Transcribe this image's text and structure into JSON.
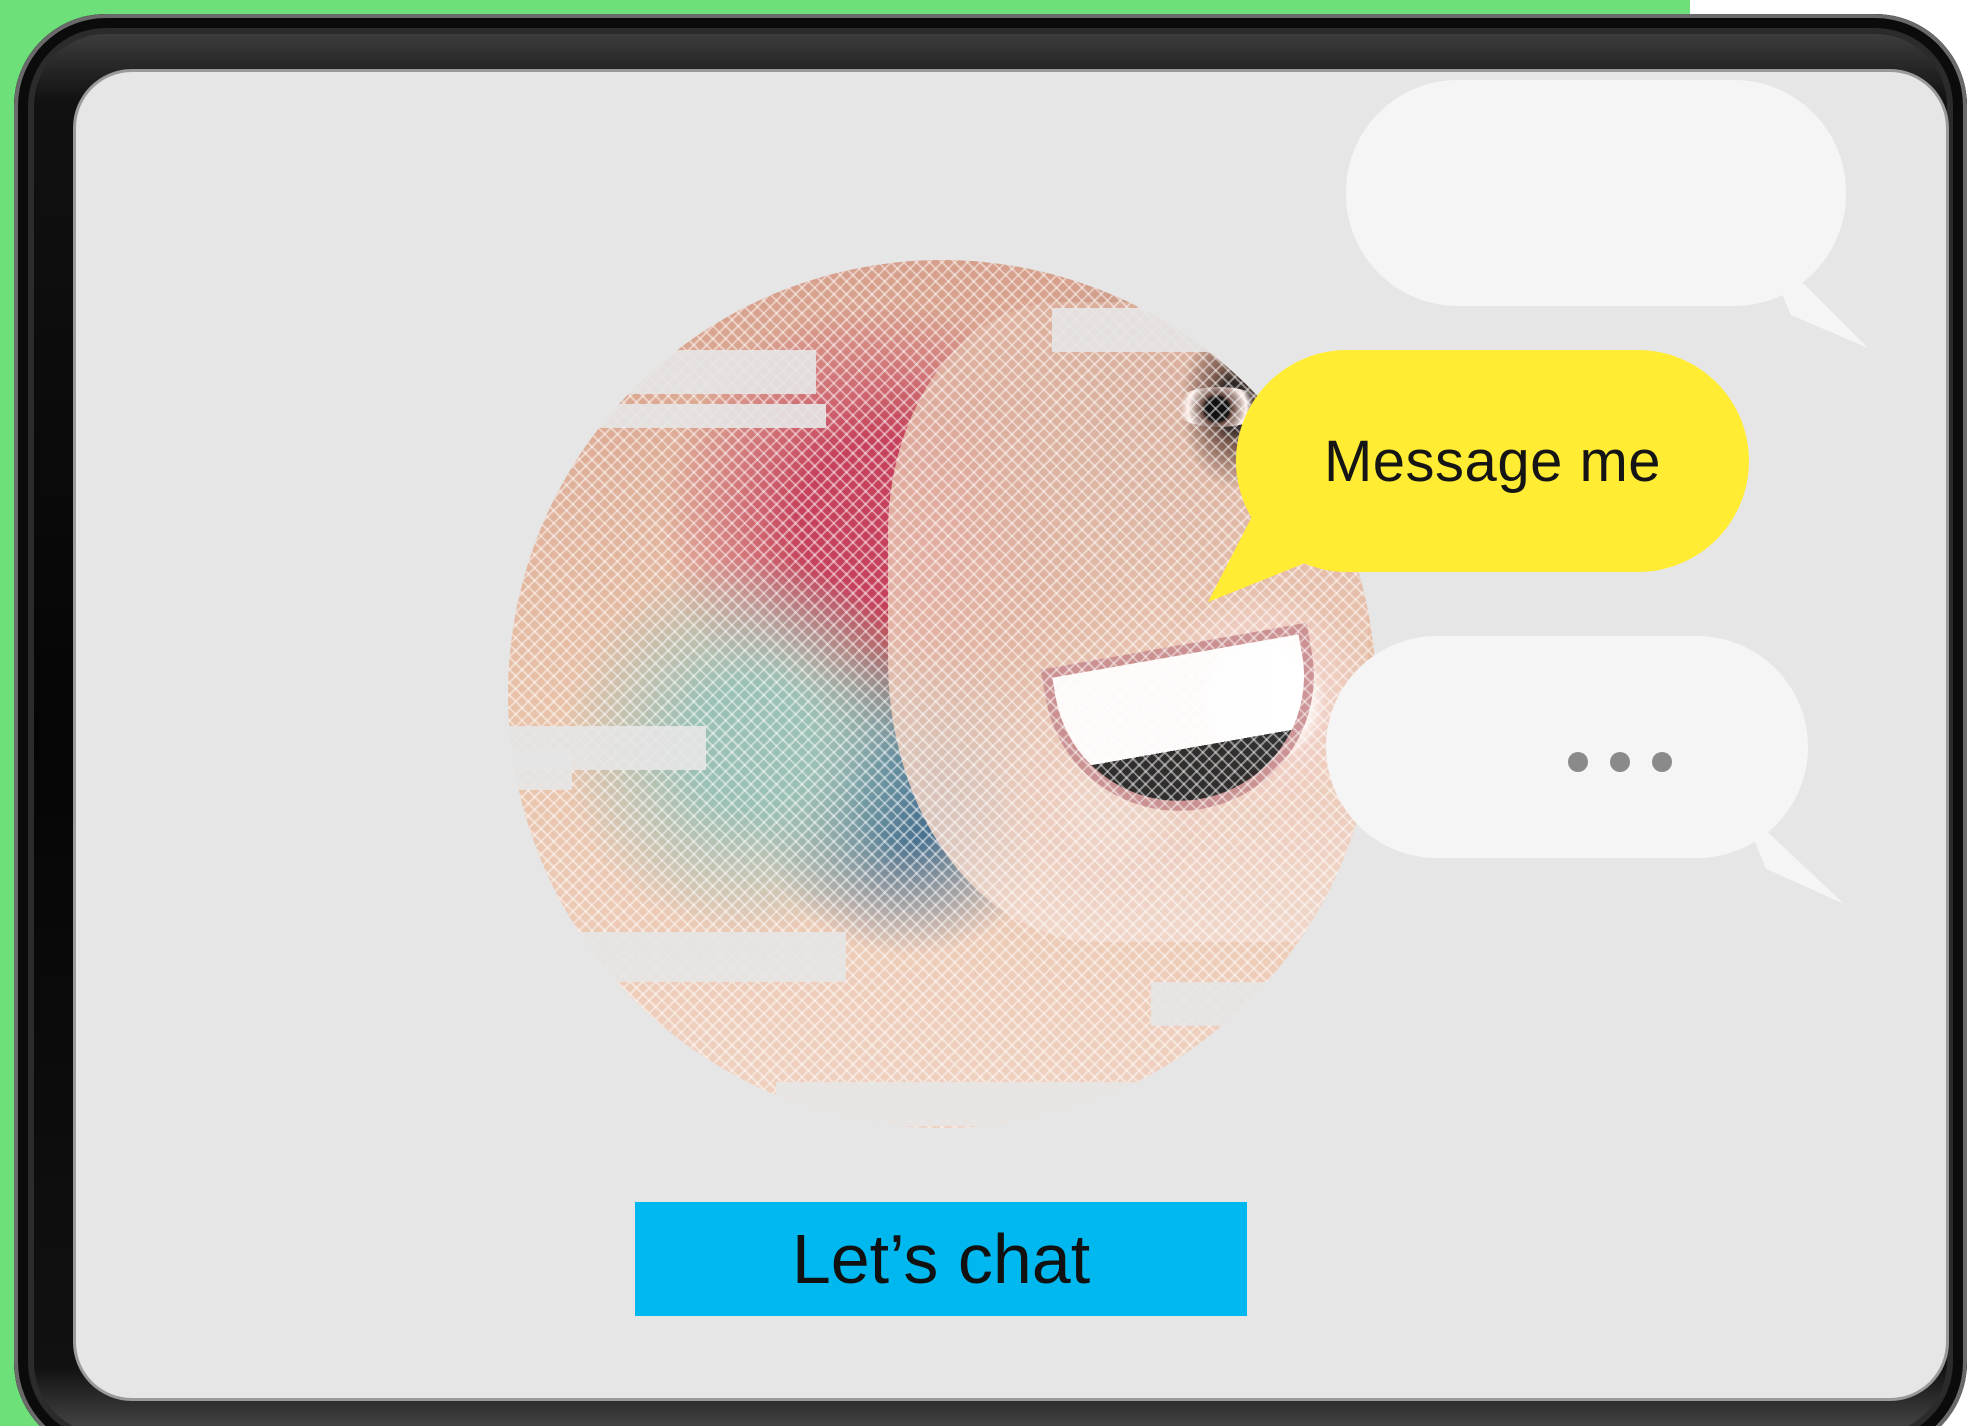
{
  "promo": {
    "message_bubble": "Message me",
    "typing_indicator": "...",
    "chat_button": "Let’s chat"
  },
  "colors": {
    "background_green": "#6ee07a",
    "device_black": "#050505",
    "screen_gray": "#e6e6e6",
    "message_yellow": "#ffec33",
    "button_blue": "#00b8f0",
    "bubble_gray": "#f5f5f5"
  },
  "icons": {
    "typing": "typing-dots-icon"
  }
}
